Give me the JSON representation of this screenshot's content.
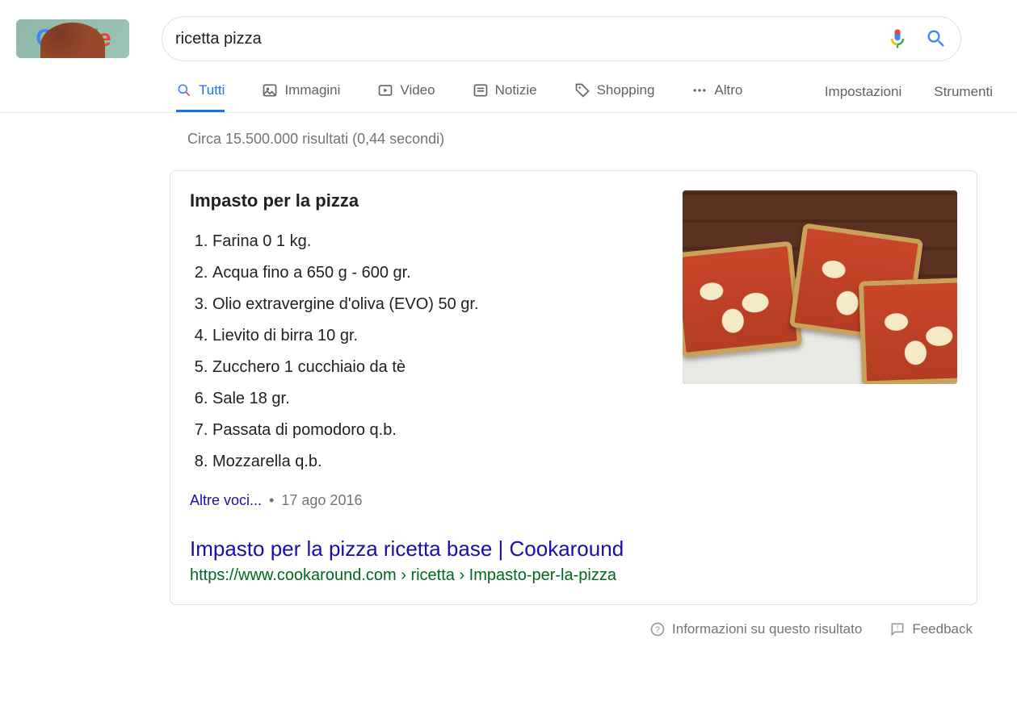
{
  "search": {
    "query": "ricetta pizza"
  },
  "tabs": {
    "all": "Tutti",
    "images": "Immagini",
    "videos": "Video",
    "news": "Notizie",
    "shopping": "Shopping",
    "more": "Altro"
  },
  "rightlinks": {
    "settings": "Impostazioni",
    "tools": "Strumenti"
  },
  "stats": "Circa 15.500.000 risultati (0,44 secondi)",
  "snippet": {
    "title": "Impasto per la pizza",
    "items": [
      "Farina 0 1 kg.",
      "Acqua fino a 650 g - 600 gr.",
      "Olio extravergine d'oliva (EVO) 50 gr.",
      "Lievito di birra 10 gr.",
      "Zucchero 1 cucchiaio da tè",
      "Sale 18 gr.",
      "Passata di pomodoro q.b.",
      "Mozzarella q.b."
    ],
    "more_label": "Altre voci...",
    "date": "17 ago 2016",
    "result_title": "Impasto per la pizza ricetta base | Cookaround",
    "result_url_display": "https://www.cookaround.com › ricetta › Impasto-per-la-pizza"
  },
  "footer": {
    "about": "Informazioni su questo risultato",
    "feedback": "Feedback"
  }
}
